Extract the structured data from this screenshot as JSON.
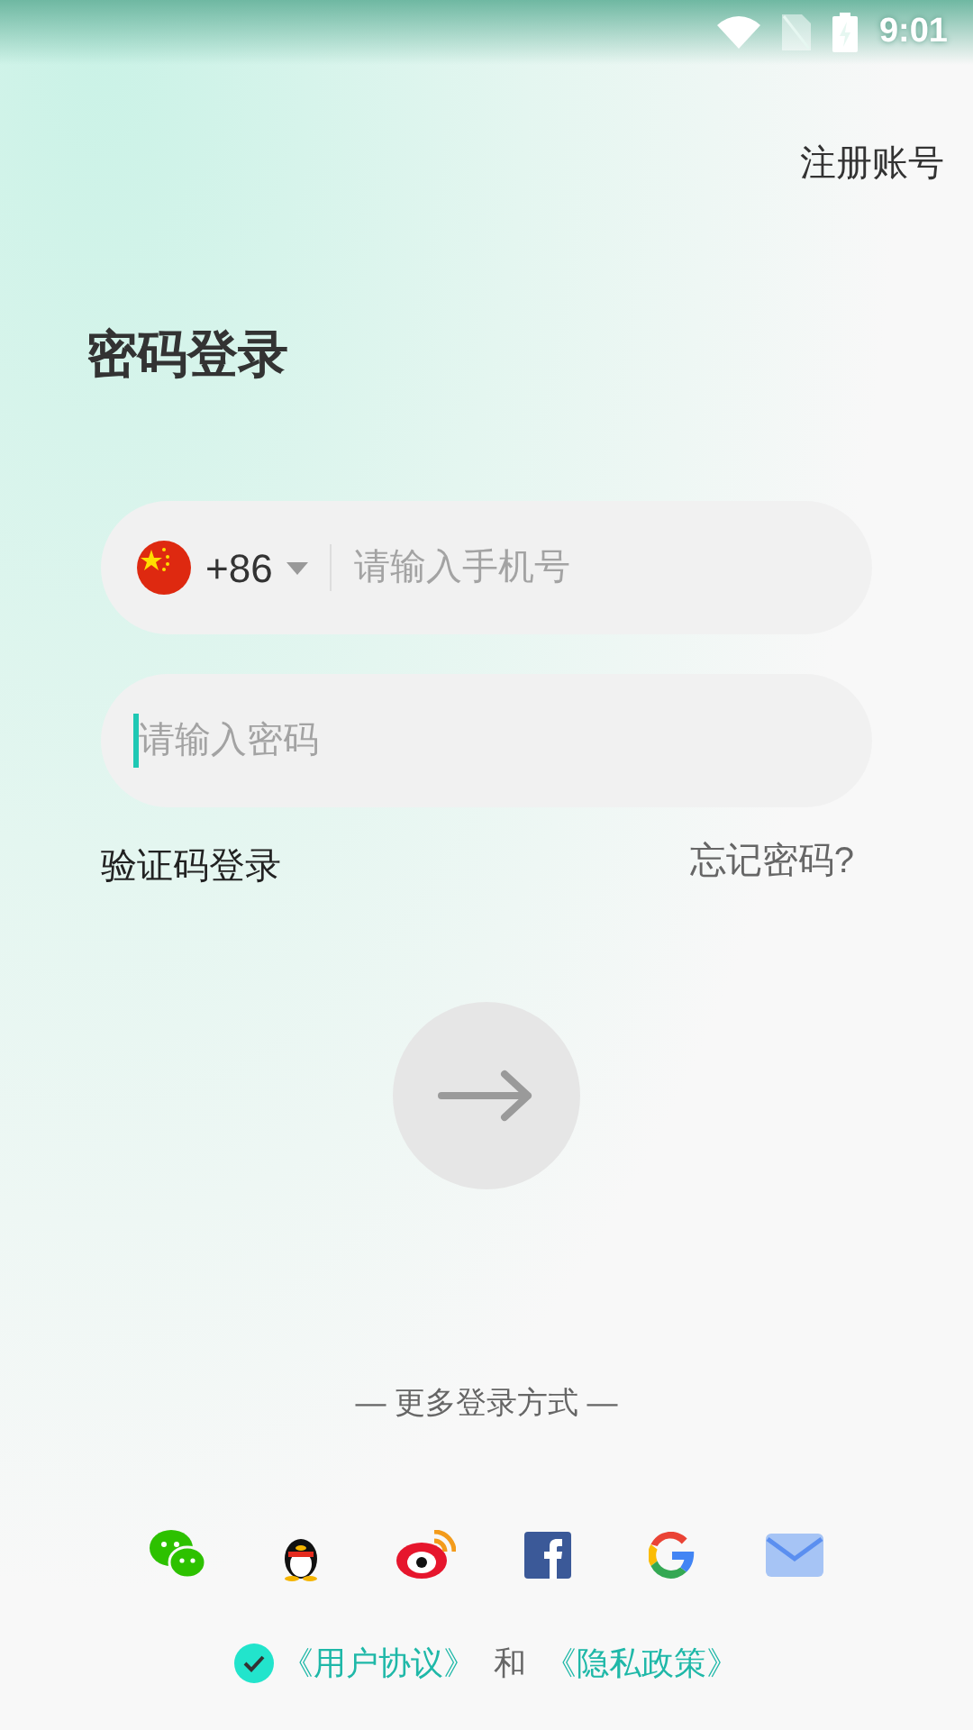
{
  "status_bar": {
    "time": "9:01"
  },
  "register_link": "注册账号",
  "title": "密码登录",
  "phone_field": {
    "country_code": "+86",
    "placeholder": "请输入手机号"
  },
  "password_field": {
    "placeholder": "请输入密码",
    "focused": true
  },
  "sms_login_link": "验证码登录",
  "forgot_password_link": "忘记密码?",
  "more_login_label": "— 更多登录方式 —",
  "agreement": {
    "checked": true,
    "user_agreement": "《用户协议》",
    "conjunction": "和",
    "privacy_policy": "《隐私政策》"
  }
}
